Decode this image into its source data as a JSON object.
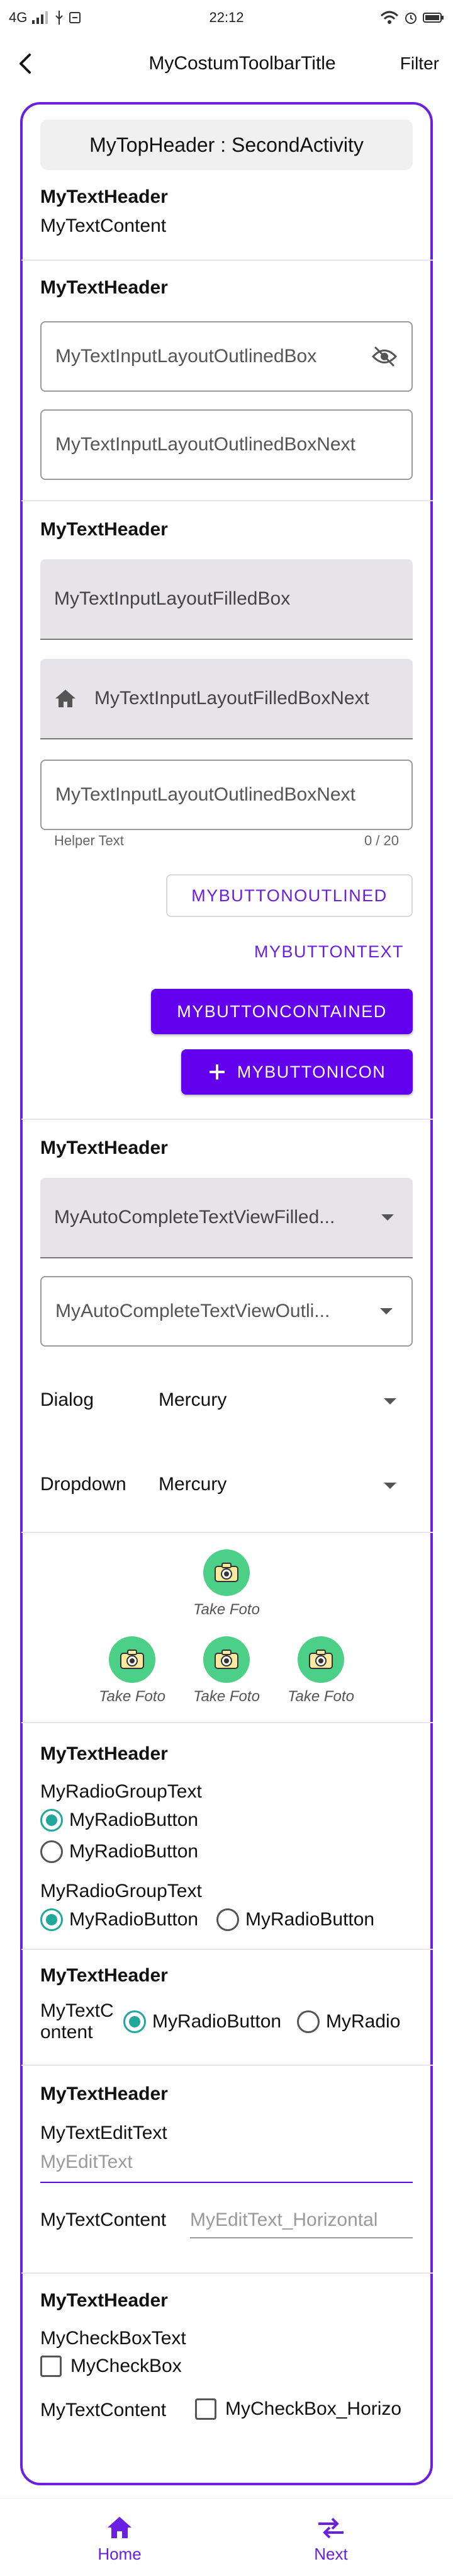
{
  "status": {
    "left": "4G",
    "time": "22:12"
  },
  "toolbar": {
    "title": "MyCostumToolbarTitle",
    "action": "Filter"
  },
  "top_header": "MyTopHeader : SecondActivity",
  "section1": {
    "header": "MyTextHeader",
    "content": "MyTextContent"
  },
  "section2": {
    "header": "MyTextHeader",
    "outlined_box": "MyTextInputLayoutOutlinedBox",
    "outlined_box_next": "MyTextInputLayoutOutlinedBoxNext"
  },
  "section3": {
    "header": "MyTextHeader",
    "filled_box": "MyTextInputLayoutFilledBox",
    "filled_box_next": "MyTextInputLayoutFilledBoxNext",
    "outlined_box_next": "MyTextInputLayoutOutlinedBoxNext",
    "helper_text": "Helper Text",
    "counter": "0 / 20"
  },
  "buttons": {
    "outlined": "MYBUTTONOUTLINED",
    "text": "MYBUTTONTEXT",
    "contained": "MYBUTTONCONTAINED",
    "icon": "MYBUTTONICON"
  },
  "section4": {
    "header": "MyTextHeader",
    "autocomplete_filled": "MyAutoCompleteTextViewFilled...",
    "autocomplete_outlined": "MyAutoCompleteTextViewOutli..."
  },
  "spinners": {
    "dialog_label": "Dialog",
    "dialog_value": "Mercury",
    "dropdown_label": "Dropdown",
    "dropdown_value": "Mercury"
  },
  "fotos": {
    "label": "Take Foto"
  },
  "section5": {
    "header": "MyTextHeader",
    "group1_title": "MyRadioGroupText",
    "group1_opt1": "MyRadioButton",
    "group1_opt2": "MyRadioButton",
    "group2_title": "MyRadioGroupText",
    "group2_opt1": "MyRadioButton",
    "group2_opt2": "MyRadioButton"
  },
  "section6": {
    "header": "MyTextHeader",
    "content_line1": "MyTextC",
    "content_line2": "ontent",
    "opt1": "MyRadioButton",
    "opt2": "MyRadio"
  },
  "section7": {
    "header": "MyTextHeader",
    "edit_title": "MyTextEditText",
    "edit_hint": "MyEditText",
    "row_label": "MyTextContent",
    "row_hint": "MyEditText_Horizontal"
  },
  "section8": {
    "header": "MyTextHeader",
    "checkbox_title": "MyCheckBoxText",
    "checkbox_label": "MyCheckBox",
    "row_label": "MyTextContent",
    "row_checkbox": "MyCheckBox_Horizo"
  },
  "nav": {
    "home": "Home",
    "next": "Next"
  },
  "colors": {
    "accent": "#6200ee",
    "frame": "#6b1fe0",
    "radio": "#20a89b",
    "foto": "#4ccf86"
  }
}
